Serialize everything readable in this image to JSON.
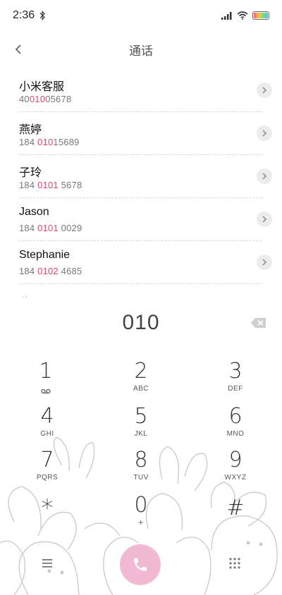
{
  "status": {
    "time": "2:36"
  },
  "header": {
    "title": "通话"
  },
  "contacts": [
    {
      "name": "小米客服",
      "number_pre": "40",
      "number_match": "010",
      "number_post": "05678"
    },
    {
      "name": "燕婷",
      "number_pre": "184 ",
      "number_match": "010",
      "number_post": "15689"
    },
    {
      "name": "子玲",
      "number_pre": "184 ",
      "number_match": "0101",
      "number_post": " 5678"
    },
    {
      "name": "Jason",
      "number_pre": "184 ",
      "number_match": "0101",
      "number_post": " 0029"
    },
    {
      "name": "Stephanie",
      "number_pre": "184 ",
      "number_match": "0102",
      "number_post": " 4685"
    }
  ],
  "partial_row": "燕丽",
  "dialer": {
    "input": "010"
  },
  "keypad": {
    "keys": [
      {
        "digit": "1",
        "letters": ""
      },
      {
        "digit": "2",
        "letters": "ABC"
      },
      {
        "digit": "3",
        "letters": "DEF"
      },
      {
        "digit": "4",
        "letters": "GHI"
      },
      {
        "digit": "5",
        "letters": "JKL"
      },
      {
        "digit": "6",
        "letters": "MNO"
      },
      {
        "digit": "7",
        "letters": "PQRS"
      },
      {
        "digit": "8",
        "letters": "TUV"
      },
      {
        "digit": "9",
        "letters": "WXYZ"
      },
      {
        "digit": "*",
        "letters": ""
      },
      {
        "digit": "0",
        "letters": "+"
      },
      {
        "digit": "#",
        "letters": ""
      }
    ]
  },
  "colors": {
    "highlight": "#e0476a",
    "call_button": "#f2b9d2"
  },
  "icons": {
    "back": "chevron-left-icon",
    "detail": "chevron-right-icon",
    "backspace": "backspace-icon",
    "call": "phone-icon",
    "menu": "menu-icon",
    "keypad": "dialpad-icon",
    "voicemail": "voicemail-icon"
  }
}
